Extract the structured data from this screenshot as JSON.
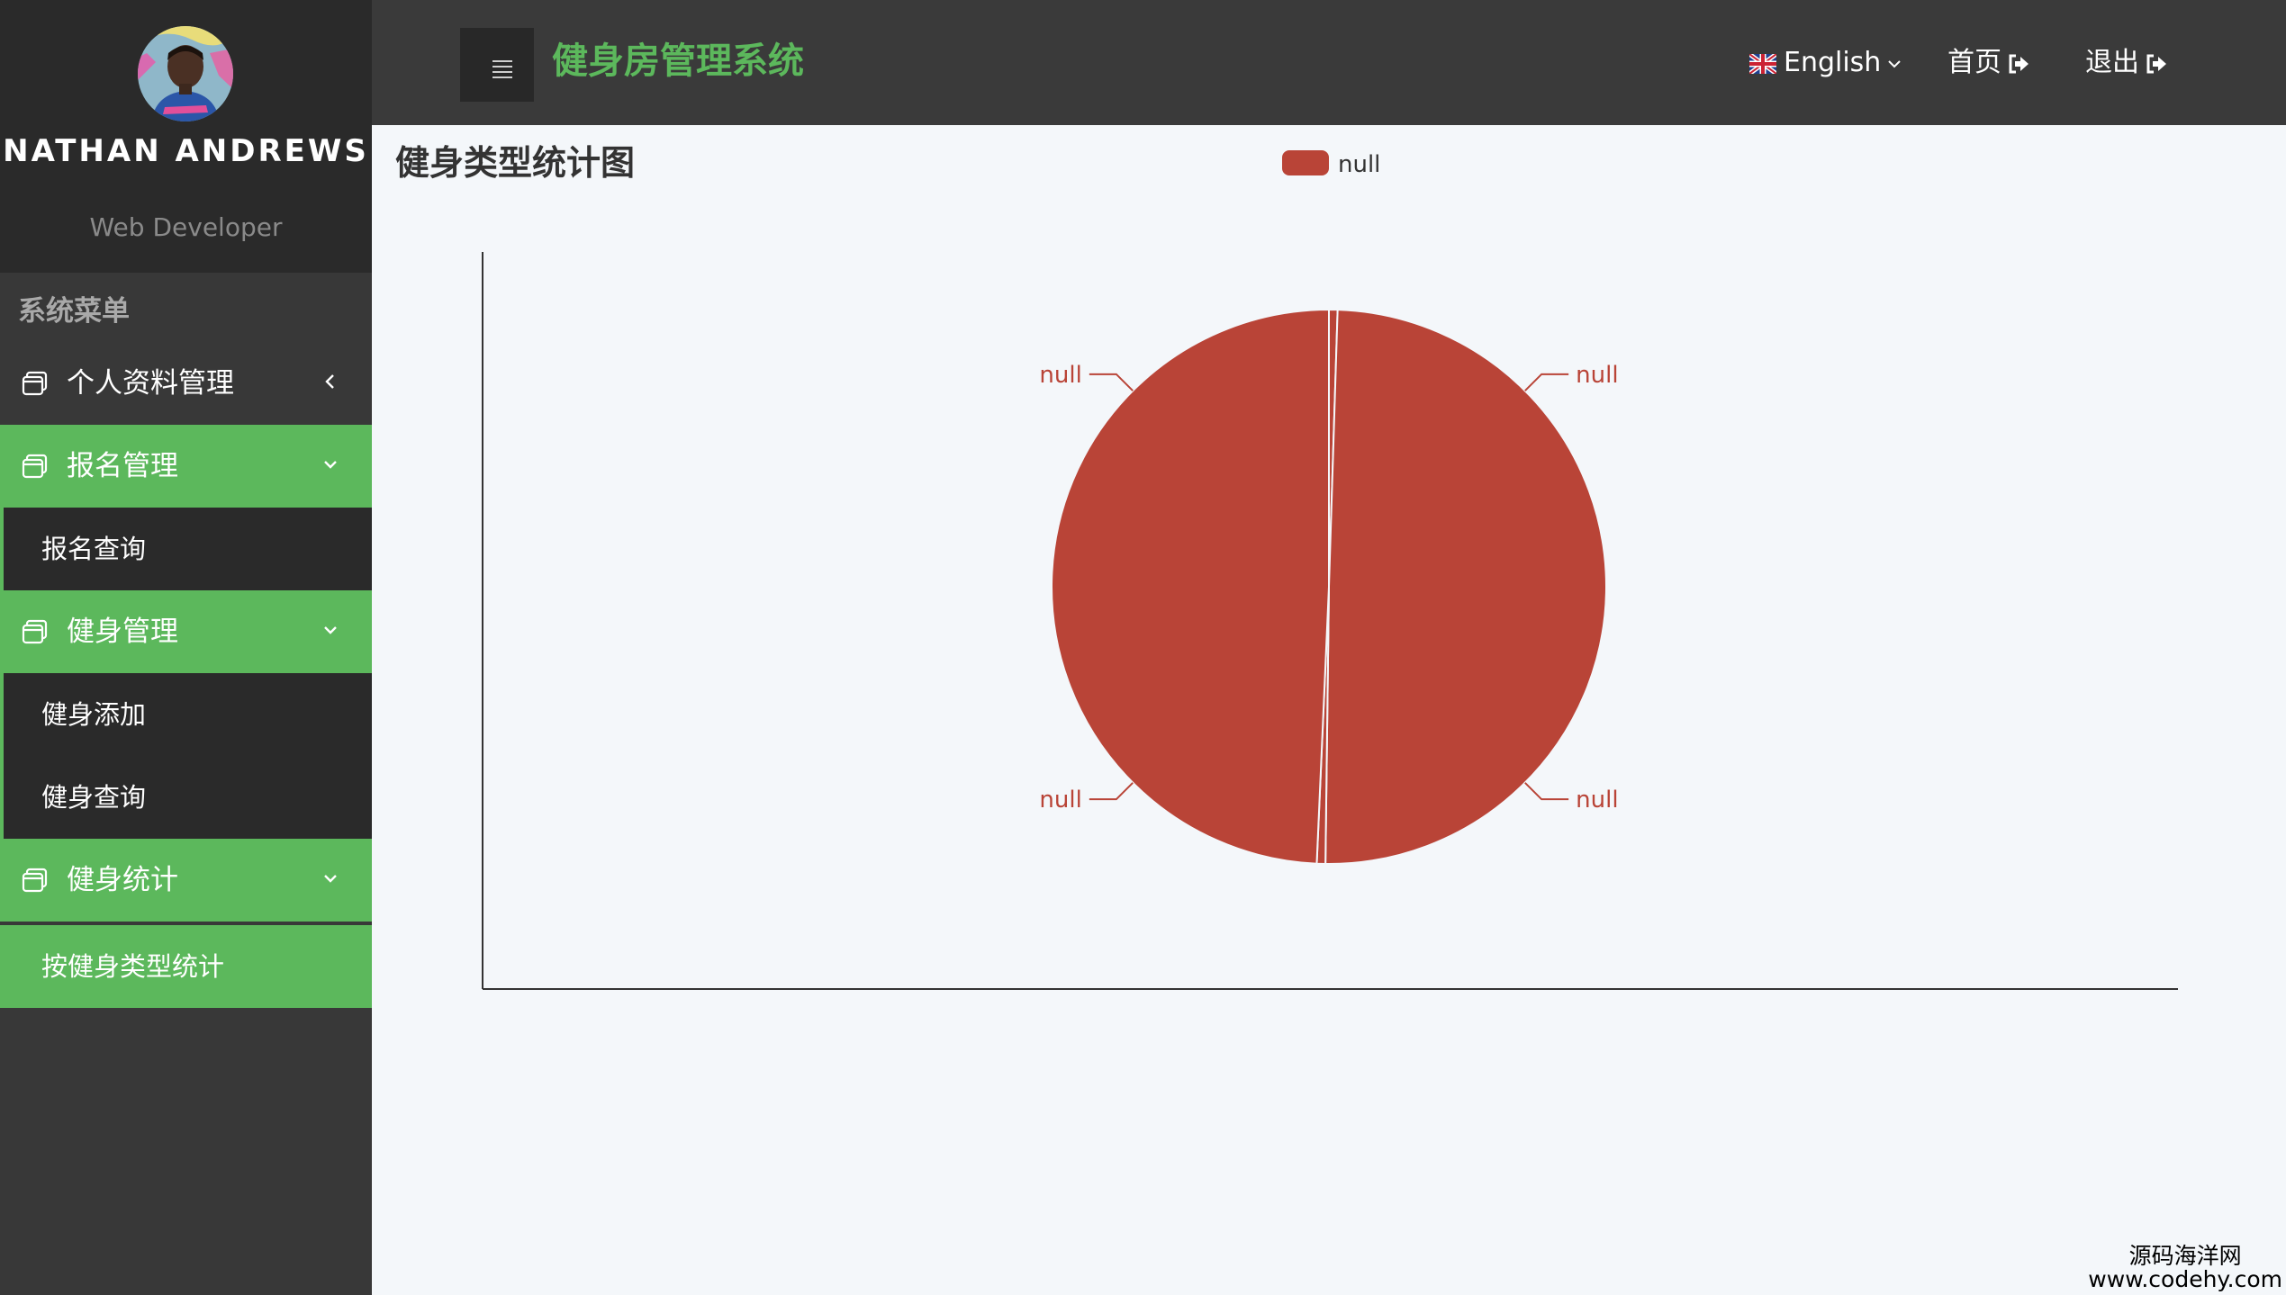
{
  "profile": {
    "name": "NATHAN ANDREWS",
    "role": "Web Developer"
  },
  "sidebar": {
    "title": "系统菜单",
    "items": [
      {
        "label": "个人资料管理",
        "icon": "window-icon",
        "chevron": "chevron-left-icon",
        "expanded": false
      },
      {
        "label": "报名管理",
        "icon": "window-icon",
        "chevron": "chevron-down-icon",
        "expanded": true,
        "children": [
          {
            "label": "报名查询"
          }
        ]
      },
      {
        "label": "健身管理",
        "icon": "window-icon",
        "chevron": "chevron-down-icon",
        "expanded": true,
        "children": [
          {
            "label": "健身添加"
          },
          {
            "label": "健身查询"
          }
        ]
      },
      {
        "label": "健身统计",
        "icon": "window-icon",
        "chevron": "chevron-down-icon",
        "expanded": true,
        "children": [
          {
            "label": "按健身类型统计",
            "active": true
          }
        ]
      }
    ]
  },
  "header": {
    "brand": "健身房管理系统",
    "language": "English",
    "home_label": "首页",
    "logout_label": "退出"
  },
  "colors": {
    "accent": "#5cb85c",
    "slice": "#b94437",
    "sidebar_bg": "#383838",
    "header_bg": "#3a3a3a"
  },
  "chart_data": {
    "type": "pie",
    "title": "健身类型统计图",
    "legend": [
      "null"
    ],
    "legend_position": "top-center",
    "slices": [
      {
        "name": "null",
        "value": 0.5
      },
      {
        "name": "null",
        "value": 49.7
      },
      {
        "name": "null",
        "value": 0.5
      },
      {
        "name": "null",
        "value": 49.3
      }
    ],
    "axes_visible": true
  },
  "watermark": {
    "line1": "源码海洋网",
    "line2": "www.codehy.com"
  }
}
